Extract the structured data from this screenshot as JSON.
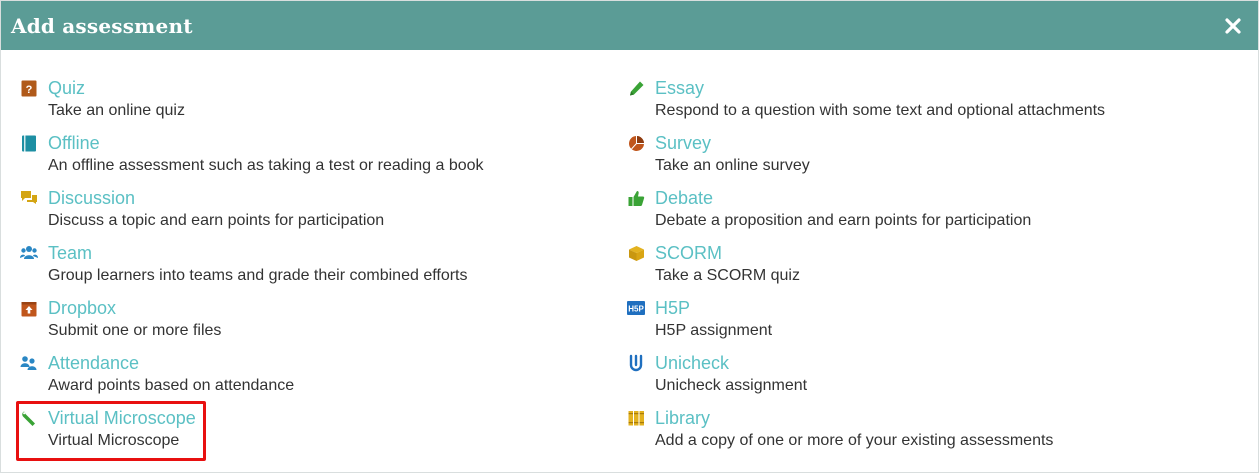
{
  "header": {
    "title": "Add assessment",
    "close_icon": "close-icon"
  },
  "colors": {
    "header_bg": "#5b9c96",
    "link": "#5bc0c4",
    "text": "#333333",
    "highlight": "#e81010"
  },
  "left_items": [
    {
      "title": "Quiz",
      "desc": "Take an online quiz",
      "icon": "quiz-icon"
    },
    {
      "title": "Offline",
      "desc": "An offline assessment such as taking a test or reading a book",
      "icon": "book-icon"
    },
    {
      "title": "Discussion",
      "desc": "Discuss a topic and earn points for participation",
      "icon": "comments-icon"
    },
    {
      "title": "Team",
      "desc": "Group learners into teams and grade their combined efforts",
      "icon": "users-icon"
    },
    {
      "title": "Dropbox",
      "desc": "Submit one or more files",
      "icon": "upload-box-icon"
    },
    {
      "title": "Attendance",
      "desc": "Award points based on attendance",
      "icon": "group-icon"
    },
    {
      "title": "Virtual Microscope",
      "desc": "Virtual Microscope",
      "icon": "wrench-icon",
      "highlighted": true
    }
  ],
  "right_items": [
    {
      "title": "Essay",
      "desc": "Respond to a question with some text and optional attachments",
      "icon": "pencil-icon"
    },
    {
      "title": "Survey",
      "desc": "Take an online survey",
      "icon": "pie-chart-icon"
    },
    {
      "title": "Debate",
      "desc": "Debate a proposition and earn points for participation",
      "icon": "thumbs-up-icon"
    },
    {
      "title": "SCORM",
      "desc": "Take a SCORM quiz",
      "icon": "cube-icon"
    },
    {
      "title": "H5P",
      "desc": "H5P assignment",
      "icon": "h5p-icon",
      "icon_text": "H5P"
    },
    {
      "title": "Unicheck",
      "desc": "Unicheck assignment",
      "icon": "unicheck-icon"
    },
    {
      "title": "Library",
      "desc": "Add a copy of one or more of your existing assessments",
      "icon": "library-icon"
    }
  ]
}
